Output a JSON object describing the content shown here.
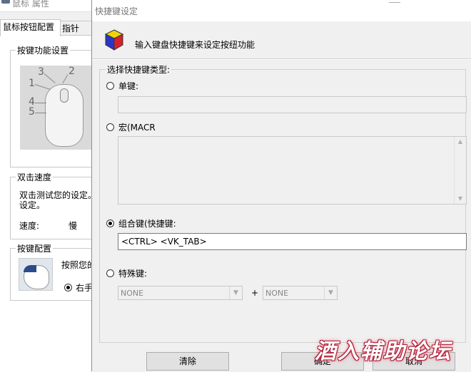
{
  "background_window": {
    "title": "鼠标 属性",
    "tabs": [
      "鼠标按钮配置",
      "指针"
    ],
    "button_function_group": "按键功能设置",
    "mouse_numbers": [
      "1",
      "2",
      "3",
      "4",
      "5"
    ],
    "double_click_group": "双击速度",
    "double_click_text_line1": "双击测试您的设定。",
    "double_click_text_line2": "设定。",
    "speed_label": "速度:",
    "speed_value": "慢",
    "button_config_group": "按键配置",
    "button_config_text": "按照您的",
    "right_hand_label": "右手"
  },
  "dialog": {
    "title": "快捷键设定",
    "header_text": "输入键盘快捷键来设定按纽功能",
    "type_group_label": "选择快捷键类型:",
    "options": {
      "single": {
        "label": "单键:",
        "checked": false,
        "value": ""
      },
      "macro": {
        "label": "宏(MACRO",
        "checked": false,
        "value": ""
      },
      "combo": {
        "label": "组合键(快捷键:",
        "checked": true,
        "value": "<CTRL> <VK_TAB>"
      },
      "special": {
        "label": "特殊键:",
        "checked": false,
        "select1": "NONE",
        "plus": "+",
        "select2": "NONE"
      }
    },
    "buttons": {
      "clear": "清除",
      "ok": "确定",
      "cancel": "取消"
    }
  },
  "watermark": "酒入辅助论坛"
}
